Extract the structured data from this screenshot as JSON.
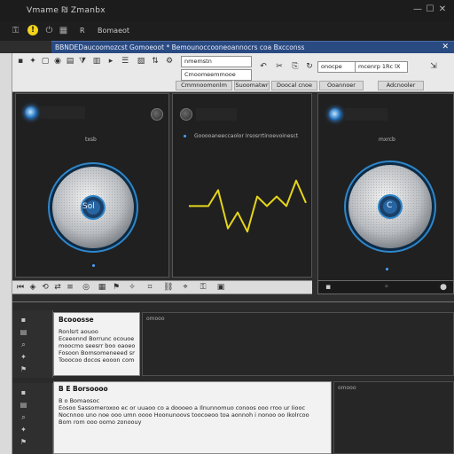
{
  "window": {
    "title": "Vmame ₪ Zmanbx",
    "controls": [
      "—",
      "☐",
      "✕"
    ]
  },
  "cmdbar": {
    "warning_glyph": "!",
    "label_one": "R",
    "label_two": "Bomaeot"
  },
  "address": {
    "text": "BBNDEDaucoomozcst Gomoeoot * Bemounoccooneoannocrs coa Bxcconss",
    "close_glyph": "✕"
  },
  "toolbar": {
    "field_one": "nmemstn",
    "field_two": "Cmoomeemmooe",
    "field_three": "onocpe",
    "field_four": "mcenrp 1Rc lX",
    "tabs": [
      "Cmmnoomonlm",
      "Suoomatwr",
      "Doocal cnoe",
      "Ooannoer",
      "Adcnooler"
    ]
  },
  "panels": {
    "left_title": "txsb",
    "mid_header": "Gooooaneeccaolor Irsosrrtinoevoinesct",
    "right_title": "mxrcb",
    "left_disc_label": "Sol",
    "right_disc_label": "C"
  },
  "waveform": {
    "color": "#e5d51a",
    "points_y": [
      0.45,
      0.45,
      0.45,
      0.2,
      0.8,
      0.55,
      0.85,
      0.3,
      0.45,
      0.3,
      0.45,
      0.05,
      0.4
    ]
  },
  "doc_top": {
    "heading": "Bcooosse",
    "lines": [
      "Ronlsrt aouoo",
      "Eceeonnd Borrunc ocouoe sosood Oleemurg",
      "moocmo seesrr boo oaoeoomnrosoo ploocr",
      "Fosoon Bomsomeneeed smouoo ilocs",
      "Tooocoo docos eooon comcoe"
    ]
  },
  "doc_bottom": {
    "heading": "B E Borsoooo",
    "lines": [
      "B  o Bomaosoc",
      "Eosoo Sassomeroxoo ec or uuaoo co a doooeo a Ilnunnomuo conoos ooo rroo ur Iiooc",
      "Nocnnoo uno noe ooo umn oooo Hoonunoovs toocoeoo toa aonnoh i nonoo oo Ikolrcoo",
      "Bom rom ooo oomo zonoouy"
    ]
  },
  "panes": {
    "top_right_title": "omooo",
    "bottom_right_title": "omooo"
  }
}
